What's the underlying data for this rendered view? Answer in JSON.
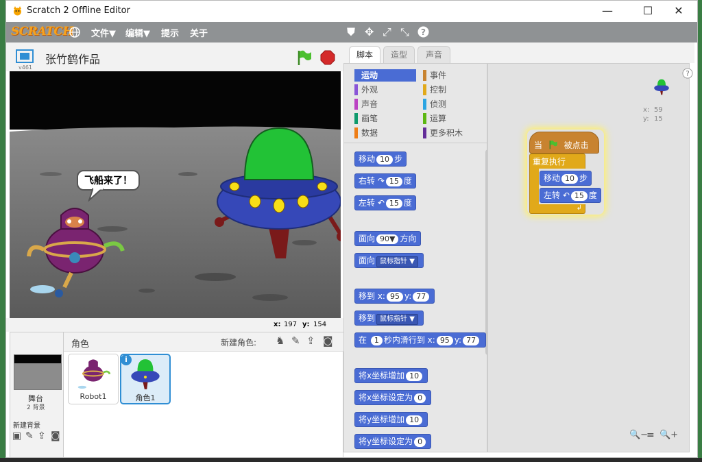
{
  "window": {
    "title": "Scratch 2 Offline Editor",
    "min": "—",
    "max": "☐",
    "close": "✕"
  },
  "menu": {
    "logo": "SCRATCH",
    "file": "文件▼",
    "edit": "编辑▼",
    "tips": "提示",
    "about": "关于"
  },
  "stage": {
    "project_name": "张竹鹤作品",
    "version": "v461",
    "speech": "飞船来了！",
    "x_label": "x:",
    "x_value": "197",
    "y_label": "y:",
    "y_value": "154"
  },
  "sprites": {
    "header": "角色",
    "new_sprite": "新建角色:",
    "stage_label": "舞台",
    "stage_backdrops": "2 背景",
    "new_backdrop": "新建背景",
    "items": [
      {
        "name": "Robot1"
      },
      {
        "name": "角色1"
      }
    ]
  },
  "tabs": {
    "scripts": "脚本",
    "costumes": "造型",
    "sounds": "声音"
  },
  "categories": [
    {
      "label": "运动",
      "color": "#4a6cd4",
      "active": true
    },
    {
      "label": "事件",
      "color": "#c88330"
    },
    {
      "label": "外观",
      "color": "#8a55d7"
    },
    {
      "label": "控制",
      "color": "#e1a91a"
    },
    {
      "label": "声音",
      "color": "#bb42c3"
    },
    {
      "label": "侦测",
      "color": "#2ca5e2"
    },
    {
      "label": "画笔",
      "color": "#0e9a6c"
    },
    {
      "label": "运算",
      "color": "#5cb712"
    },
    {
      "label": "数据",
      "color": "#ee7d16"
    },
    {
      "label": "更多积木",
      "color": "#632d99"
    }
  ],
  "blocks": {
    "move": {
      "a": "移动",
      "n": "10",
      "b": "步"
    },
    "turn_right": {
      "a": "右转",
      "icon": "↷",
      "n": "15",
      "b": "度"
    },
    "turn_left": {
      "a": "左转",
      "icon": "↶",
      "n": "15",
      "b": "度"
    },
    "point_dir": {
      "a": "面向",
      "n": "90▼",
      "b": "方向"
    },
    "point_towards": {
      "a": "面向",
      "dd": "鼠标指针 ▼"
    },
    "goto_xy": {
      "a": "移到 x:",
      "x": "95",
      "b": "y:",
      "y": "77"
    },
    "goto": {
      "a": "移到",
      "dd": "鼠标指针 ▼"
    },
    "glide": {
      "a": "在",
      "n": "1",
      "b": "秒内滑行到 x:",
      "x": "95",
      "c": "y:",
      "y": "77"
    },
    "change_x": {
      "a": "将x坐标增加",
      "n": "10"
    },
    "set_x": {
      "a": "将x坐标设定为",
      "n": "0"
    },
    "change_y": {
      "a": "将y坐标增加",
      "n": "10"
    },
    "set_y": {
      "a": "将y坐标设定为",
      "n": "0"
    }
  },
  "script": {
    "hat_a": "当",
    "hat_b": "被点击",
    "forever": "重复执行",
    "move": {
      "a": "移动",
      "n": "10",
      "b": "步"
    },
    "turn": {
      "a": "左转",
      "icon": "↶",
      "n": "15",
      "b": "度"
    },
    "x_label": "x:",
    "x_value": "59",
    "y_label": "y:",
    "y_value": "15"
  },
  "zoom": {
    "out": "🔍−",
    "reset": "=",
    "in": "🔍+"
  }
}
